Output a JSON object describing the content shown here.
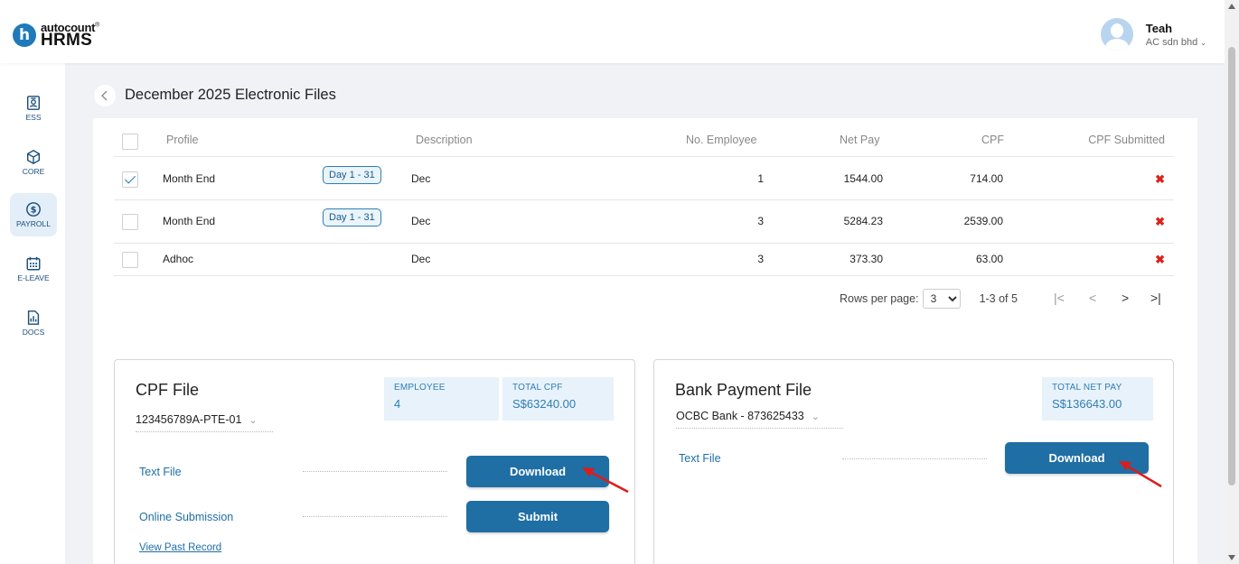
{
  "brand": {
    "top": "autocount",
    "bottom": "HRMS",
    "logo_letter": "h"
  },
  "user": {
    "name": "Teah",
    "company": "AC sdn bhd"
  },
  "sidebar": {
    "items": [
      {
        "label": "ESS",
        "icon": "contact-card-icon"
      },
      {
        "label": "CORE",
        "icon": "cube-icon"
      },
      {
        "label": "PAYROLL",
        "icon": "dollar-icon"
      },
      {
        "label": "E-LEAVE",
        "icon": "calendar-icon"
      },
      {
        "label": "DOCS",
        "icon": "document-chart-icon"
      }
    ],
    "active": "PAYROLL"
  },
  "page": {
    "title": "December 2025 Electronic Files"
  },
  "table": {
    "headers": {
      "profile": "Profile",
      "description": "Description",
      "employees": "No. Employee",
      "net_pay": "Net Pay",
      "cpf": "CPF",
      "cpf_submitted": "CPF Submitted"
    },
    "rows": [
      {
        "checked": true,
        "profile": "Month End",
        "tag": "Day 1 - 31",
        "description": "Dec",
        "employees": "1",
        "net_pay": "1544.00",
        "cpf": "714.00",
        "cpf_submitted": "✖"
      },
      {
        "checked": false,
        "profile": "Month End",
        "tag": "Day 1 - 31",
        "description": "Dec",
        "employees": "3",
        "net_pay": "5284.23",
        "cpf": "2539.00",
        "cpf_submitted": "✖"
      },
      {
        "checked": false,
        "profile": "Adhoc",
        "tag": "",
        "description": "Dec",
        "employees": "3",
        "net_pay": "373.30",
        "cpf": "63.00",
        "cpf_submitted": "✖"
      }
    ],
    "pagination": {
      "rows_per_page_label": "Rows per page:",
      "rows_per_page": "3",
      "range": "1-3 of 5"
    }
  },
  "cpf_panel": {
    "title": "CPF File",
    "account": "123456789A-PTE-01",
    "employee_label": "EMPLOYEE",
    "employee_value": "4",
    "total_label": "TOTAL CPF",
    "total_value": "S$63240.00",
    "text_file_label": "Text File",
    "download_label": "Download",
    "online_label": "Online Submission",
    "submit_label": "Submit",
    "view_past_label": "View Past Record"
  },
  "bank_panel": {
    "title": "Bank Payment File",
    "account": "OCBC Bank - 873625433",
    "total_label": "TOTAL NET PAY",
    "total_value": "S$136643.00",
    "text_file_label": "Text File",
    "download_label": "Download"
  },
  "colors": {
    "accent": "#1f6ea4",
    "error": "#d9231d",
    "tag_border": "#2f7db5",
    "annotation_arrow": "#e01b1b"
  }
}
